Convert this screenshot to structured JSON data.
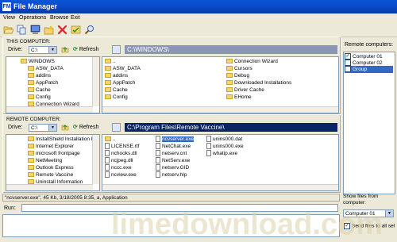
{
  "window": {
    "title": "File Manager",
    "app_icon_text": "FM"
  },
  "menu": [
    "View",
    "Operations",
    "Browse",
    "Exit"
  ],
  "toolbar_icons": [
    "open-folder-icon",
    "copy-icon",
    "computer-icon",
    "new-folder-icon",
    "delete-icon",
    "checklist-icon",
    "search-icon"
  ],
  "this_computer": {
    "label": "THIS COMPUTER:",
    "drive_label": "Drive:",
    "drive_value": "C:\\",
    "refresh_label": "Refresh",
    "path": "C:\\WINDOWS\\",
    "tree": [
      "WINDOWS",
      "ASW_DATA",
      "addins",
      "AppPatch",
      "Cache",
      "Config",
      "Connection Wizard"
    ],
    "files_col1": [
      "..",
      "ASW_DATA",
      "addins",
      "AppPatch",
      "Cache",
      "Config"
    ],
    "files_col2": [
      "Connection Wizard",
      "Cursors",
      "Debug",
      "Downloaded Installations",
      "Driver Cache",
      "EHome"
    ]
  },
  "remote_computer": {
    "label": "REMOTE COMPUTER:",
    "drive_label": "Drive:",
    "drive_value": "C:\\",
    "refresh_label": "Refresh",
    "path": "C:\\Program Files\\Remote Vaccine\\",
    "tree": [
      "InstallShield Installation In",
      "Internet Explorer",
      "microsoft frontpage",
      "NetMeeting",
      "Outlook Express",
      "Remote Vaccine",
      "Uninstall Information"
    ],
    "files_col1": [
      "..",
      "LICENSE.rtf",
      "nchooks.dll",
      "ncjpeg.dll",
      "nccc.exe",
      "ncview.exe"
    ],
    "files_col2": [
      "ncvserver.exe",
      "NetChat.exe",
      "netserv.cnt",
      "NetServ.exe",
      "netserv.GID",
      "netserv.hlp"
    ],
    "files_col3": [
      "unins000.dat",
      "unins000.exe",
      "whatip.exe"
    ]
  },
  "remote_computers_panel": {
    "label": "Remote computers:",
    "items": [
      {
        "label": "Computer 01",
        "checked": true,
        "selected": false
      },
      {
        "label": "Computer 02",
        "checked": false,
        "selected": false
      },
      {
        "label": "Group",
        "checked": false,
        "selected": true
      }
    ]
  },
  "status_text": "\"ncvserver.exe\", 45 Kb, 3/18/2005 8:35, a, Application",
  "run": {
    "label": "Run:",
    "value": ""
  },
  "show_files_from": {
    "label": "Show files from computer:",
    "value": "Computer 01"
  },
  "send_files": {
    "label": "Send files to all sel",
    "checked": true
  },
  "watermark_text": "limedownload.com",
  "colors": {
    "title_bar": "#0a56d8",
    "path_bar_remote": "#0a2468",
    "path_bar_local": "#8a95b8",
    "selection": "#316ac5",
    "background": "#ece9d8"
  }
}
